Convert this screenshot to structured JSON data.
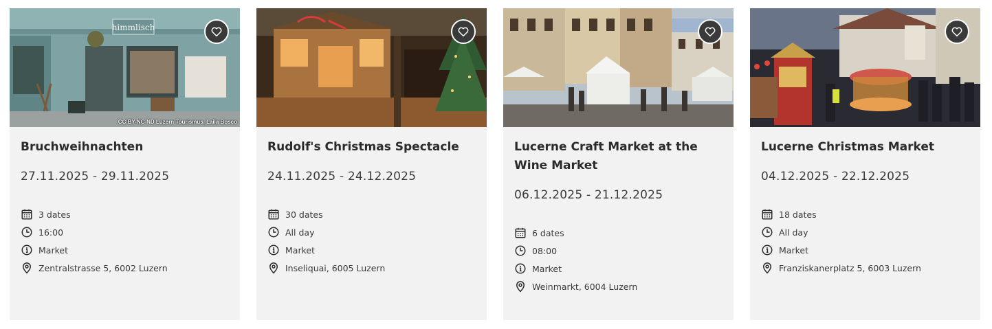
{
  "cards": [
    {
      "title": "Bruchweihnachten",
      "dates": "27.11.2025 - 29.11.2025",
      "count": "3 dates",
      "time": "16:00",
      "category": "Market",
      "address": "Zentralstrasse 5, 6002 Luzern",
      "credit": "CC BY-NC-ND Luzern Tourismus, Laila Bosco",
      "shop_sign": "himmlisch",
      "icons": [
        "calendar-icon",
        "clock-icon",
        "info-icon",
        "location-pin-icon",
        "heart-icon"
      ]
    },
    {
      "title": "Rudolf's Christmas Spectacle",
      "dates": "24.11.2025 - 24.12.2025",
      "count": "30 dates",
      "time": "All day",
      "category": "Market",
      "address": "Inseliquai, 6005 Luzern",
      "icons": [
        "calendar-icon",
        "clock-icon",
        "info-icon",
        "location-pin-icon",
        "heart-icon"
      ]
    },
    {
      "title": "Lucerne Craft Market at the Wine Market",
      "dates": "06.12.2025 - 21.12.2025",
      "count": "6 dates",
      "time": "08:00",
      "category": "Market",
      "address": "Weinmarkt, 6004 Luzern",
      "icons": [
        "calendar-icon",
        "clock-icon",
        "info-icon",
        "location-pin-icon",
        "heart-icon"
      ]
    },
    {
      "title": "Lucerne Christmas Market",
      "dates": "04.12.2025 - 22.12.2025",
      "count": "18 dates",
      "time": "All day",
      "category": "Market",
      "address": "Franziskanerplatz 5, 6003 Luzern",
      "icons": [
        "calendar-icon",
        "clock-icon",
        "info-icon",
        "location-pin-icon",
        "heart-icon"
      ]
    }
  ],
  "colors": {
    "card_bg": "#f2f2f2",
    "text": "#2b2b2b",
    "fav_bg": "#3a3a3a"
  }
}
